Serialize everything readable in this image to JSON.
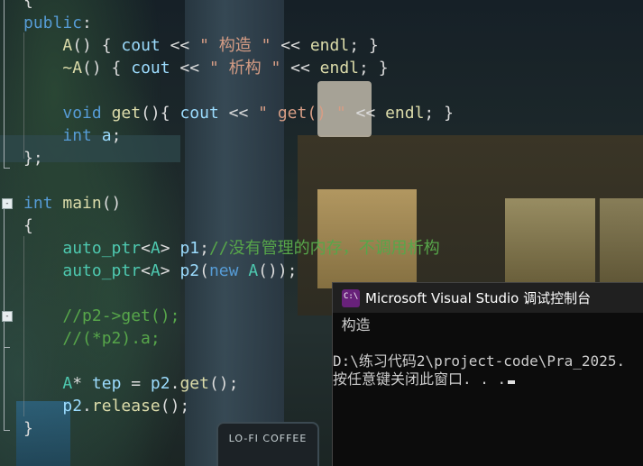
{
  "editor": {
    "lines": [
      {
        "parts": [
          {
            "c": "pl",
            "t": "{"
          }
        ]
      },
      {
        "parts": [
          {
            "c": "kw",
            "t": "public"
          },
          {
            "c": "pl",
            "t": ":"
          }
        ]
      },
      {
        "parts": [
          {
            "c": "pl",
            "t": "    "
          },
          {
            "c": "fn",
            "t": "A"
          },
          {
            "c": "pl",
            "t": "() { "
          },
          {
            "c": "id",
            "t": "cout"
          },
          {
            "c": "pl",
            "t": " << "
          },
          {
            "c": "st",
            "t": "\" 构造 \""
          },
          {
            "c": "pl",
            "t": " << "
          },
          {
            "c": "fn",
            "t": "endl"
          },
          {
            "c": "pl",
            "t": "; }"
          }
        ]
      },
      {
        "parts": [
          {
            "c": "pl",
            "t": "    "
          },
          {
            "c": "fn",
            "t": "~A"
          },
          {
            "c": "pl",
            "t": "() { "
          },
          {
            "c": "id",
            "t": "cout"
          },
          {
            "c": "pl",
            "t": " << "
          },
          {
            "c": "st",
            "t": "\" 析构 \""
          },
          {
            "c": "pl",
            "t": " << "
          },
          {
            "c": "fn",
            "t": "endl"
          },
          {
            "c": "pl",
            "t": "; }"
          }
        ]
      },
      {
        "parts": []
      },
      {
        "parts": [
          {
            "c": "pl",
            "t": "    "
          },
          {
            "c": "kw",
            "t": "void"
          },
          {
            "c": "pl",
            "t": " "
          },
          {
            "c": "fn",
            "t": "get"
          },
          {
            "c": "pl",
            "t": "(){ "
          },
          {
            "c": "id",
            "t": "cout"
          },
          {
            "c": "pl",
            "t": " << "
          },
          {
            "c": "st",
            "t": "\" get() \""
          },
          {
            "c": "pl",
            "t": " << "
          },
          {
            "c": "fn",
            "t": "endl"
          },
          {
            "c": "pl",
            "t": "; }"
          }
        ]
      },
      {
        "parts": [
          {
            "c": "pl",
            "t": "    "
          },
          {
            "c": "kw",
            "t": "int"
          },
          {
            "c": "pl",
            "t": " "
          },
          {
            "c": "id",
            "t": "a"
          },
          {
            "c": "pl",
            "t": ";"
          }
        ]
      },
      {
        "parts": [
          {
            "c": "pl",
            "t": "};"
          }
        ]
      },
      {
        "parts": []
      },
      {
        "parts": [
          {
            "c": "kw",
            "t": "int"
          },
          {
            "c": "pl",
            "t": " "
          },
          {
            "c": "fn",
            "t": "main"
          },
          {
            "c": "pl",
            "t": "()"
          }
        ]
      },
      {
        "parts": [
          {
            "c": "pl",
            "t": "{"
          }
        ]
      },
      {
        "parts": [
          {
            "c": "pl",
            "t": "    "
          },
          {
            "c": "ty",
            "t": "auto_ptr"
          },
          {
            "c": "pl",
            "t": "<"
          },
          {
            "c": "ty",
            "t": "A"
          },
          {
            "c": "pl",
            "t": "> "
          },
          {
            "c": "id",
            "t": "p1"
          },
          {
            "c": "pl",
            "t": ";"
          },
          {
            "c": "cm",
            "t": "//没有管理的内存，不调用析构"
          }
        ]
      },
      {
        "parts": [
          {
            "c": "pl",
            "t": "    "
          },
          {
            "c": "ty",
            "t": "auto_ptr"
          },
          {
            "c": "pl",
            "t": "<"
          },
          {
            "c": "ty",
            "t": "A"
          },
          {
            "c": "pl",
            "t": "> "
          },
          {
            "c": "id",
            "t": "p2"
          },
          {
            "c": "pl",
            "t": "("
          },
          {
            "c": "kw",
            "t": "new"
          },
          {
            "c": "pl",
            "t": " "
          },
          {
            "c": "ty",
            "t": "A"
          },
          {
            "c": "pl",
            "t": "());"
          }
        ]
      },
      {
        "parts": []
      },
      {
        "parts": [
          {
            "c": "pl",
            "t": "    "
          },
          {
            "c": "cm",
            "t": "//p2->get();"
          }
        ]
      },
      {
        "parts": [
          {
            "c": "pl",
            "t": "    "
          },
          {
            "c": "cm",
            "t": "//(*p2).a;"
          }
        ]
      },
      {
        "parts": []
      },
      {
        "parts": [
          {
            "c": "pl",
            "t": "    "
          },
          {
            "c": "ty",
            "t": "A"
          },
          {
            "c": "pl",
            "t": "* "
          },
          {
            "c": "id",
            "t": "tep"
          },
          {
            "c": "pl",
            "t": " = "
          },
          {
            "c": "id",
            "t": "p2"
          },
          {
            "c": "pl",
            "t": "."
          },
          {
            "c": "fn",
            "t": "get"
          },
          {
            "c": "pl",
            "t": "();"
          }
        ]
      },
      {
        "parts": [
          {
            "c": "pl",
            "t": "    "
          },
          {
            "c": "id",
            "t": "p2"
          },
          {
            "c": "pl",
            "t": "."
          },
          {
            "c": "fn",
            "t": "release"
          },
          {
            "c": "pl",
            "t": "();"
          }
        ]
      },
      {
        "parts": [
          {
            "c": "pl",
            "t": "}"
          }
        ]
      }
    ]
  },
  "console": {
    "title": "Microsoft Visual Studio 调试控制台",
    "lines": [
      " 构造",
      "",
      "D:\\练习代码2\\project-code\\Pra_2025.",
      "按任意键关闭此窗口. . ."
    ]
  },
  "background": {
    "sign_text": "LO-FI COFFEE"
  },
  "colors": {
    "keyword": "#569cd6",
    "type": "#4ec9b0",
    "function": "#dcdcaa",
    "string": "#d69d85",
    "comment": "#57a64a",
    "identifier": "#9cdcfe",
    "console_bg": "#0c0c0c",
    "titlebar_bg": "#202020"
  }
}
